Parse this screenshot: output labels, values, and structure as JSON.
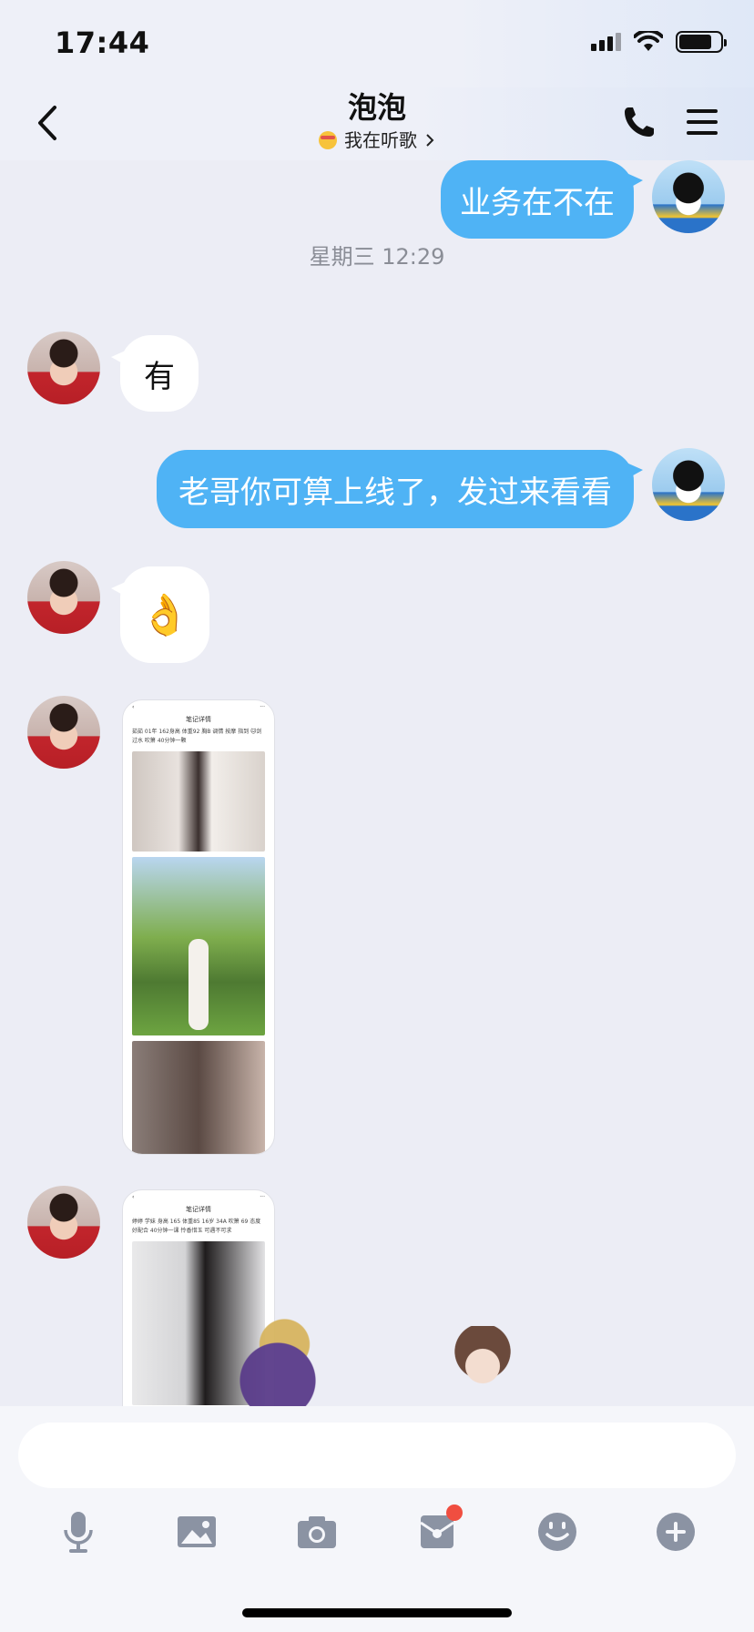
{
  "status_bar": {
    "time": "17:44"
  },
  "header": {
    "title": "泡泡",
    "subtitle": "我在听歌"
  },
  "messages": [
    {
      "sender": "me",
      "type": "text",
      "text": "业务在不在"
    },
    {
      "type": "timestamp",
      "text": "星期三 12:29"
    },
    {
      "sender": "other",
      "type": "text",
      "text": "有"
    },
    {
      "sender": "me",
      "type": "text",
      "text": "老哥你可算上线了，发过来看看"
    },
    {
      "sender": "other",
      "type": "emoji",
      "text": "👌"
    },
    {
      "sender": "other",
      "type": "image",
      "header": "笔记详情",
      "caption": "茹茹 01年 162身高 体重92 胸B 调情 按摩 指到 🐱剑 过水 吹箫 40分钟一颗"
    },
    {
      "sender": "other",
      "type": "image",
      "header": "笔记详情",
      "caption": "婷婷 学妹 身高 165 体重85 16岁 34A 吹箫 69 态度好配合 40分钟一课 怜香惜玉 可遇不可求"
    }
  ],
  "input": {
    "placeholder": ""
  },
  "toolbar": [
    "voice-icon",
    "image-icon",
    "camera-icon",
    "red-packet-icon",
    "emoji-icon",
    "plus-icon"
  ],
  "colors": {
    "outgoing_bubble": "#4fb3f5",
    "incoming_bubble": "#ffffff",
    "background": "#ecedf5",
    "notification_dot": "#f04e40"
  }
}
